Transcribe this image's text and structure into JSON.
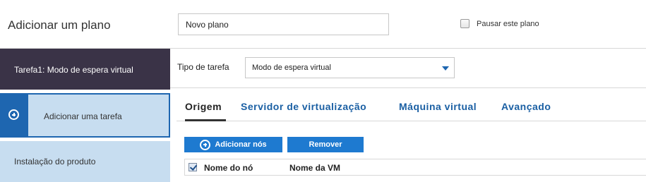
{
  "header": {
    "title": "Adicionar um plano",
    "plan_name_value": "Novo plano",
    "pause_label": "Pausar este plano",
    "pause_checked": false
  },
  "sidebar": {
    "items": [
      {
        "label": "Tarefa1: Modo de espera virtual",
        "state": "selected"
      },
      {
        "label": "Adicionar uma tarefa",
        "icon": "plus-circle-icon"
      },
      {
        "label": "Instalação do produto"
      }
    ]
  },
  "task_type": {
    "label": "Tipo de tarefa",
    "selected": "Modo de espera virtual"
  },
  "tabs": [
    {
      "label": "Origem",
      "active": true
    },
    {
      "label": "Servidor de virtualização",
      "active": false
    },
    {
      "label": "Máquina virtual",
      "active": false
    },
    {
      "label": "Avançado",
      "active": false
    }
  ],
  "buttons": {
    "add_nodes": "Adicionar nós",
    "remove": "Remover"
  },
  "table": {
    "columns": [
      "Nome do nó",
      "Nome da VM"
    ],
    "rows": []
  },
  "colors": {
    "accent": "#1e7ad0",
    "sidebar_dark": "#3a3347",
    "sidebar_light": "#c7ddf0",
    "tab_link": "#1a5fa3"
  }
}
